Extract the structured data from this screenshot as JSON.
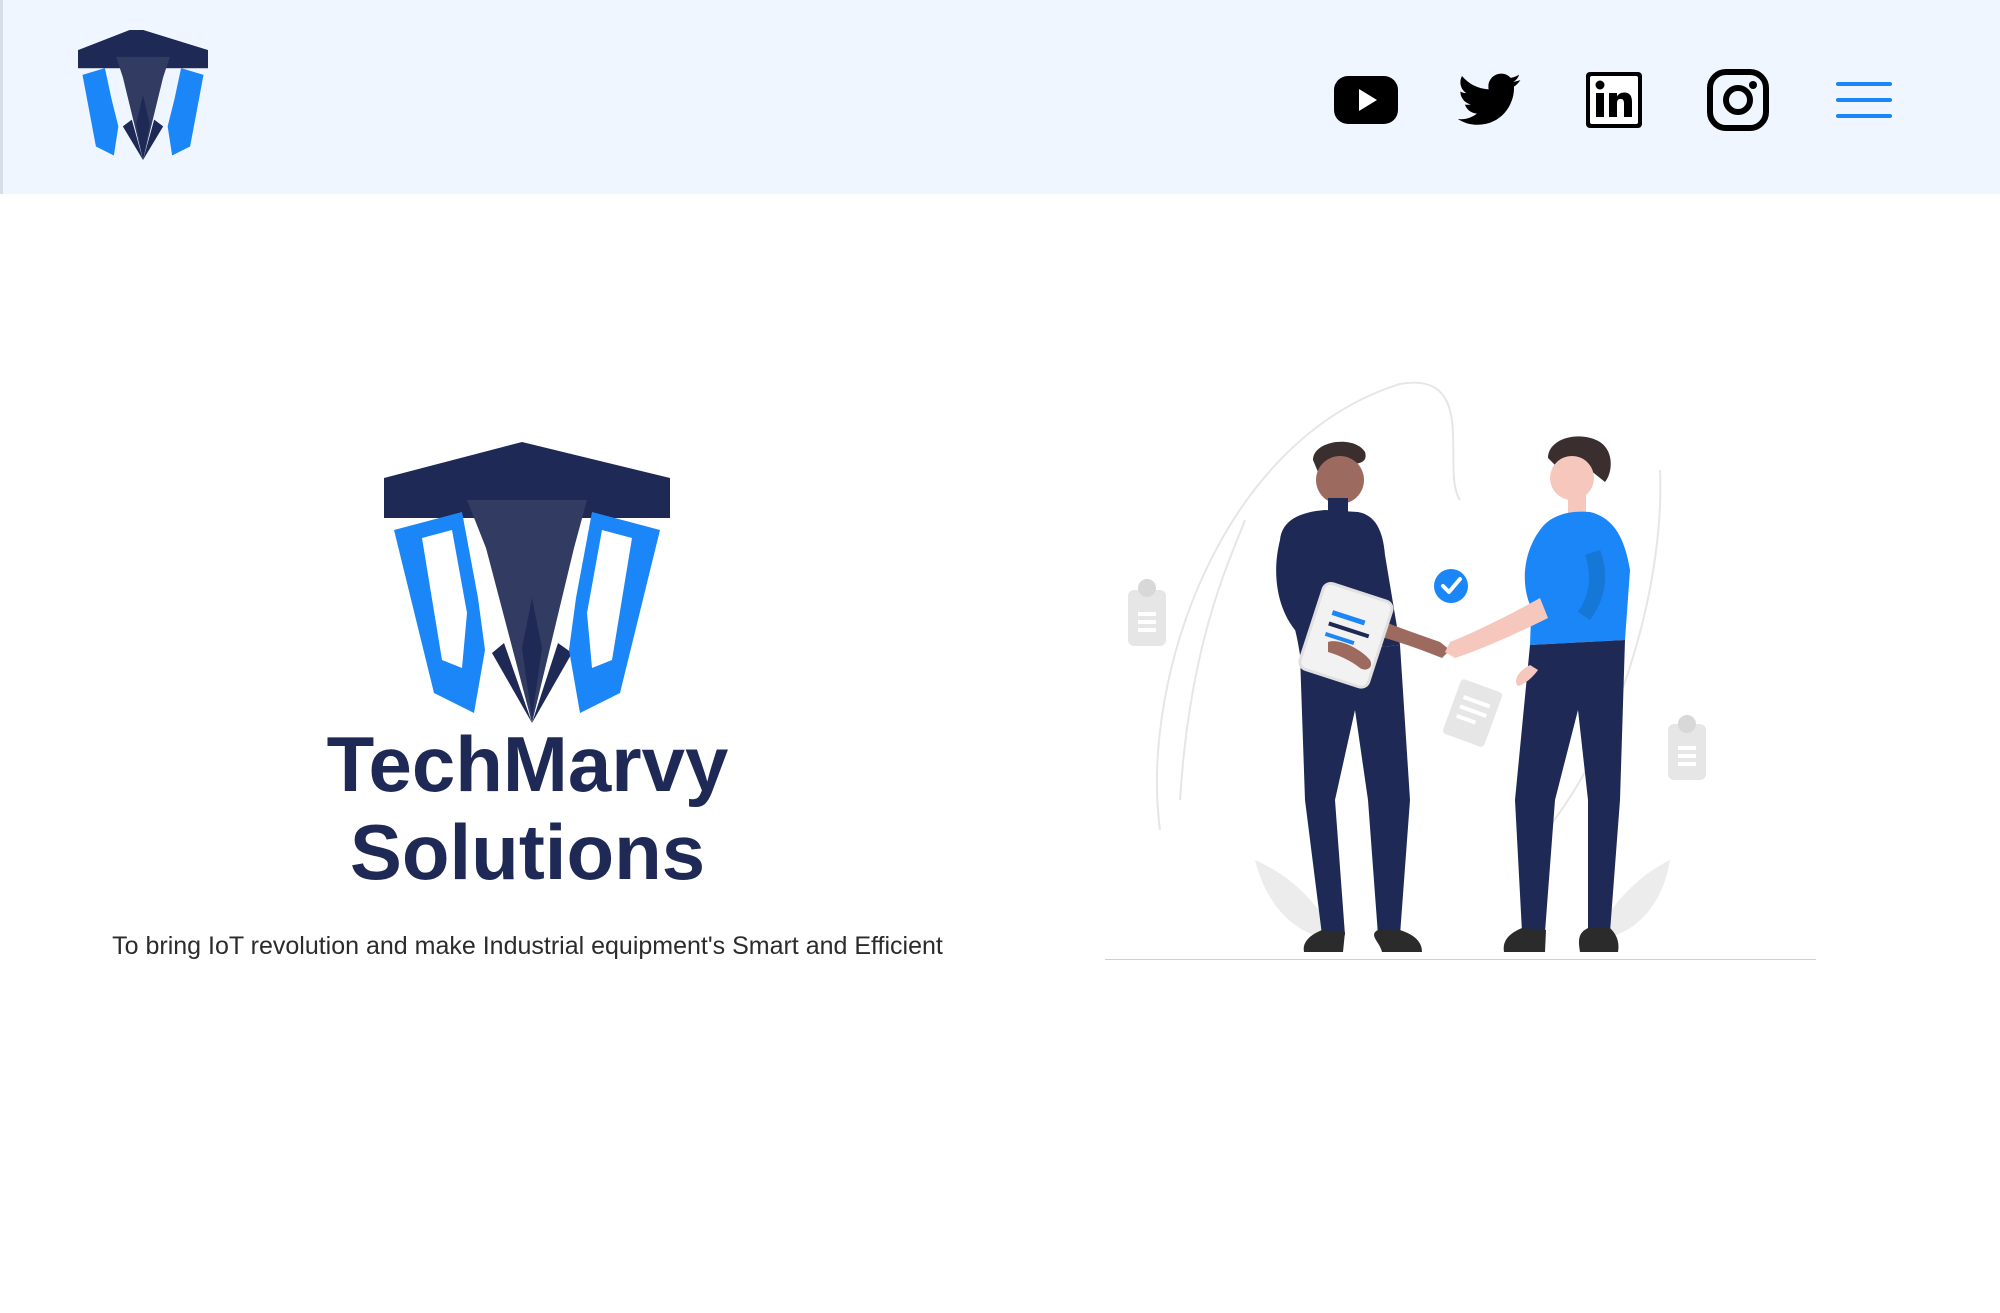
{
  "brand": {
    "name_line1": "TechMarvy",
    "name_line2": "Solutions",
    "tagline": "To bring IoT revolution and make Industrial equipment's Smart and Efficient",
    "colors": {
      "navy": "#1e2955",
      "slate": "#323b62",
      "blue": "#1b86f7",
      "header_bg": "#eff6ff"
    }
  },
  "header": {
    "social_links": [
      {
        "name": "youtube",
        "icon": "youtube-icon"
      },
      {
        "name": "twitter",
        "icon": "twitter-icon"
      },
      {
        "name": "linkedin",
        "icon": "linkedin-icon"
      },
      {
        "name": "instagram",
        "icon": "instagram-icon"
      }
    ],
    "menu_icon": "hamburger-menu-icon"
  },
  "hero": {
    "illustration": "two people shaking hands with document and checkmark"
  }
}
